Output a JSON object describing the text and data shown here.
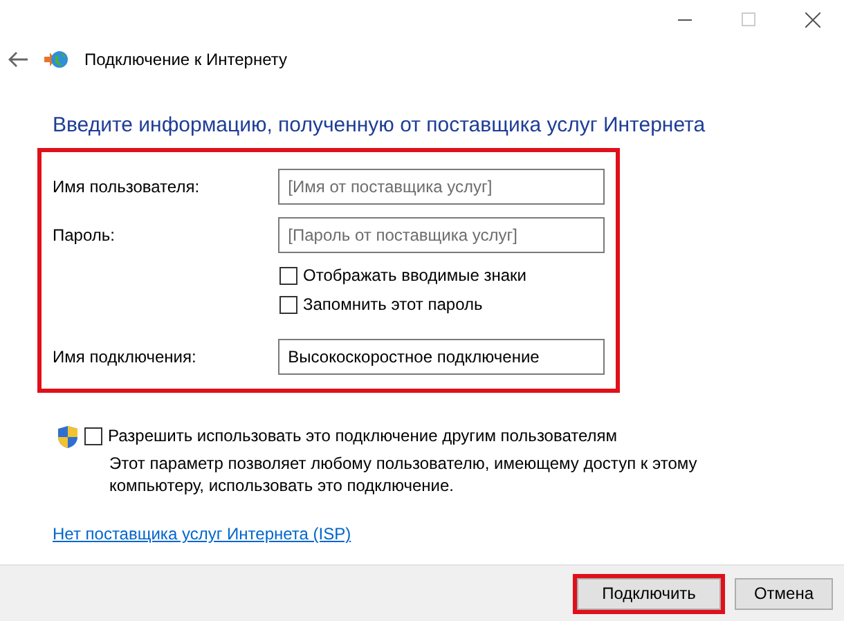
{
  "window": {
    "title": "Подключение к Интернету"
  },
  "heading": "Введите информацию, полученную от поставщика услуг Интернета",
  "form": {
    "highlighted": true,
    "fields": [
      {
        "label": "Имя пользователя:",
        "placeholder": "[Имя от поставщика услуг]"
      },
      {
        "label": "Пароль:",
        "placeholder": "[Пароль от поставщика услуг]"
      }
    ],
    "options": [
      {
        "label": "Отображать вводимые знаки",
        "checked": false
      },
      {
        "label": "Запомнить этот пароль",
        "checked": false
      }
    ],
    "connection_name": {
      "label": "Имя подключения:",
      "value": "Высокоскоростное подключение"
    }
  },
  "share": {
    "label": "Разрешить использовать это подключение другим пользователям",
    "checked": false,
    "description": "Этот параметр позволяет любому пользователю, имеющему доступ к этому компьютеру, использовать это подключение."
  },
  "link": "Нет поставщика услуг Интернета (ISP)",
  "buttons": [
    {
      "label": "Подключить",
      "highlighted": true
    },
    {
      "label": "Отмена",
      "highlighted": false
    }
  ]
}
